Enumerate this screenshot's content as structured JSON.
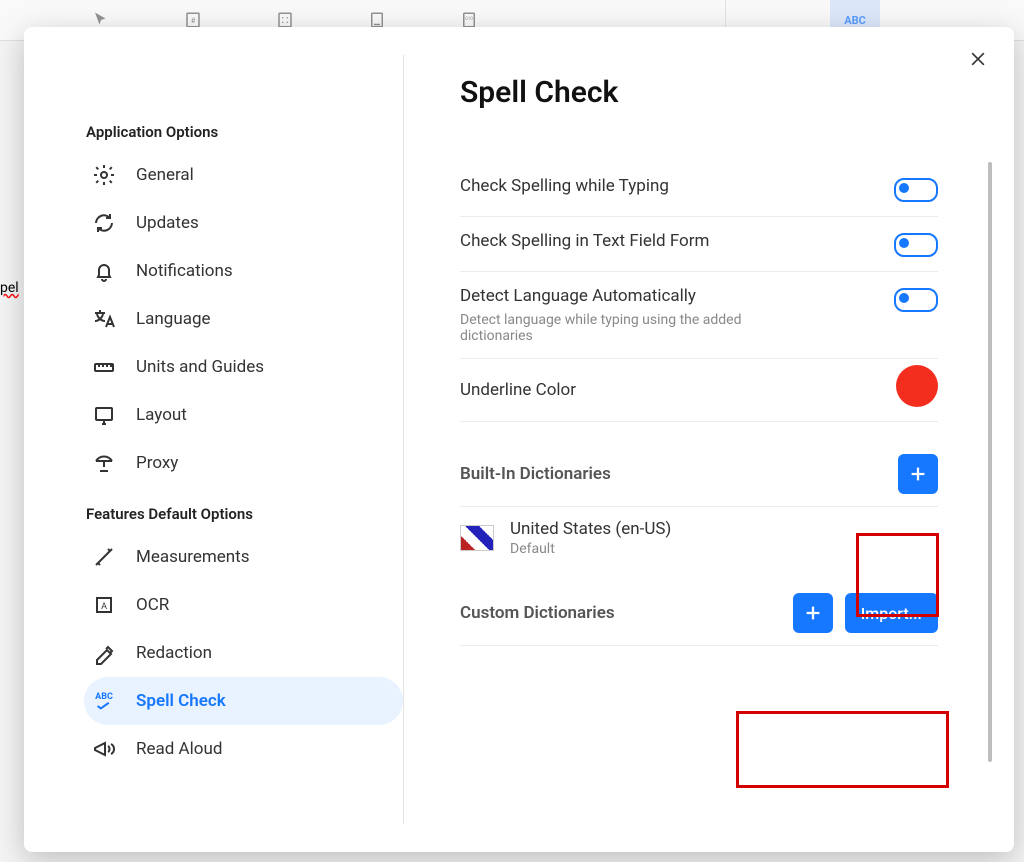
{
  "sidebar": {
    "section1_title": "Application Options",
    "section2_title": "Features Default Options",
    "items1": [
      {
        "label": "General"
      },
      {
        "label": "Updates"
      },
      {
        "label": "Notifications"
      },
      {
        "label": "Language"
      },
      {
        "label": "Units and Guides"
      },
      {
        "label": "Layout"
      },
      {
        "label": "Proxy"
      }
    ],
    "items2": [
      {
        "label": "Measurements"
      },
      {
        "label": "OCR"
      },
      {
        "label": "Redaction"
      },
      {
        "label": "Spell Check"
      },
      {
        "label": "Read Aloud"
      }
    ]
  },
  "main": {
    "title": "Spell Check",
    "opt1": "Check Spelling while Typing",
    "opt2": "Check Spelling in Text Field Form",
    "opt3": "Detect Language Automatically",
    "opt3_sub": "Detect language while typing using the added dictionaries",
    "opt4": "Underline Color",
    "underline_color": "#f32e1f",
    "builtin_title": "Built-In Dictionaries",
    "builtin": {
      "name": "United States (en-US)",
      "default": "Default"
    },
    "custom_title": "Custom Dictionaries",
    "import_label": "Import..."
  },
  "bg": {
    "abc": "ABC",
    "pel": "pel"
  }
}
